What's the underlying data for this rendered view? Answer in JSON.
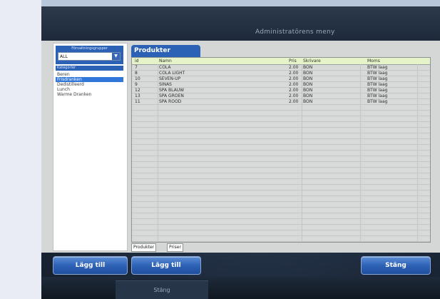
{
  "window": {
    "title": "Administratörens meny"
  },
  "sidebar": {
    "group_title": "Förvaltningsgrupper",
    "group_select_value": "ALL",
    "categories_header": "Kategorier",
    "categories": [
      {
        "label": "Beren",
        "selected": false
      },
      {
        "label": "Frisdranken",
        "selected": true
      },
      {
        "label": "Dedistilleerd",
        "selected": false
      },
      {
        "label": "Lunch",
        "selected": false
      },
      {
        "label": "Warme Dranken",
        "selected": false
      }
    ]
  },
  "products": {
    "tab_label": "Produkter",
    "columns": [
      "id",
      "Namn",
      "Pris",
      "Skrivare",
      "Moms"
    ],
    "rows": [
      [
        "7",
        "COLA",
        "2.00",
        "BON",
        "BTW laag"
      ],
      [
        "8",
        "COLA LIGHT",
        "2.00",
        "BON",
        "BTW laag"
      ],
      [
        "10",
        "SEVEN-UP",
        "2.00",
        "BON",
        "BTW laag"
      ],
      [
        "9",
        "SINAS",
        "2.00",
        "BON",
        "BTW laag"
      ],
      [
        "12",
        "SPA BLAUW",
        "2.00",
        "BON",
        "BTW laag"
      ],
      [
        "13",
        "SPA GROEN",
        "2.00",
        "BON",
        "BTW laag"
      ],
      [
        "11",
        "SPA ROOD",
        "2.00",
        "BON",
        "BTW laag"
      ]
    ],
    "bottom_tabs": [
      "Produkter",
      "Priser"
    ]
  },
  "buttons": {
    "add_category": "Lägg till",
    "add_product": "Lägg till",
    "close": "Stäng",
    "footer_close": "Stäng"
  },
  "colors": {
    "accent": "#2c62b6",
    "selection": "#3176d9",
    "header_row": "#e6f3c8"
  }
}
